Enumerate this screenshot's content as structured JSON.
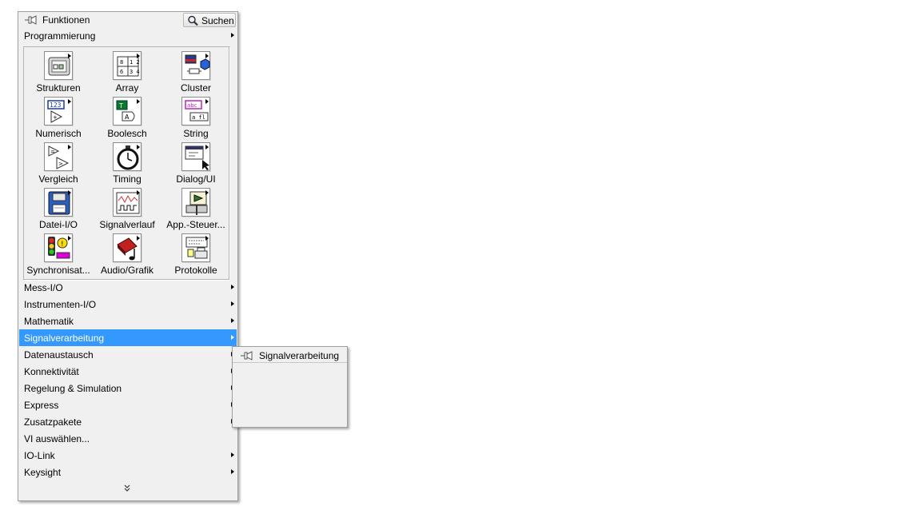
{
  "palette": {
    "title": "Funktionen",
    "search_label": "Suchen",
    "top_item": "Programmierung",
    "icons": [
      {
        "label": "Strukturen",
        "icon": "structures-icon"
      },
      {
        "label": "Array",
        "icon": "array-icon"
      },
      {
        "label": "Cluster",
        "icon": "cluster-icon"
      },
      {
        "label": "Numerisch",
        "icon": "numeric-icon"
      },
      {
        "label": "Boolesch",
        "icon": "boolean-icon"
      },
      {
        "label": "String",
        "icon": "string-icon"
      },
      {
        "label": "Vergleich",
        "icon": "comparison-icon"
      },
      {
        "label": "Timing",
        "icon": "stopwatch-icon"
      },
      {
        "label": "Dialog/UI",
        "icon": "dialog-icon"
      },
      {
        "label": "Datei-I/O",
        "icon": "floppy-disk-icon"
      },
      {
        "label": "Signalverlauf",
        "icon": "waveform-icon"
      },
      {
        "label": "App.-Steuer...",
        "icon": "app-control-icon"
      },
      {
        "label": "Synchronisat...",
        "icon": "synchronization-icon"
      },
      {
        "label": "Audio/Grafik",
        "icon": "audio-graphics-icon"
      },
      {
        "label": "Protokolle",
        "icon": "report-icon"
      }
    ],
    "categories": [
      {
        "label": "Mess-I/O",
        "has_submenu": true
      },
      {
        "label": "Instrumenten-I/O",
        "has_submenu": true
      },
      {
        "label": "Mathematik",
        "has_submenu": true
      },
      {
        "label": "Signalverarbeitung",
        "has_submenu": true,
        "selected": true
      },
      {
        "label": "Datenaustausch",
        "has_submenu": true
      },
      {
        "label": "Konnektivität",
        "has_submenu": true
      },
      {
        "label": "Regelung & Simulation",
        "has_submenu": true
      },
      {
        "label": "Express",
        "has_submenu": true
      },
      {
        "label": "Zusatzpakete",
        "has_submenu": true
      },
      {
        "label": "VI auswählen...",
        "has_submenu": false
      },
      {
        "label": "IO-Link",
        "has_submenu": true
      },
      {
        "label": "Keysight",
        "has_submenu": true
      }
    ]
  },
  "submenu": {
    "title": "Signalverarbeitung"
  },
  "colors": {
    "selection": "#3399ff",
    "panel": "#f0f0f0",
    "border": "#a0a0a0"
  }
}
